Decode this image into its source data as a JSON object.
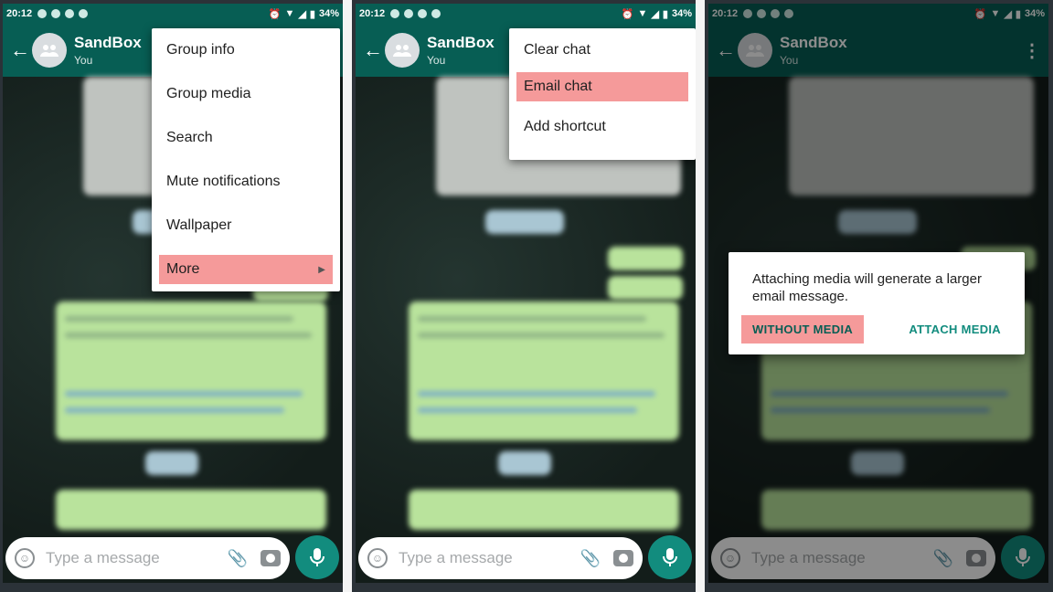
{
  "status": {
    "time": "20:12",
    "battery": "34%"
  },
  "chat": {
    "title": "SandBox",
    "subtitle": "You"
  },
  "input": {
    "placeholder": "Type a message"
  },
  "menu_main": {
    "items": [
      "Group info",
      "Group media",
      "Search",
      "Mute notifications",
      "Wallpaper",
      "More"
    ],
    "highlighted": "More"
  },
  "menu_more": {
    "items": [
      "Clear chat",
      "Email chat",
      "Add shortcut"
    ],
    "highlighted": "Email chat"
  },
  "dialog": {
    "message": "Attaching media will generate a larger email message.",
    "without_media": "WITHOUT MEDIA",
    "attach_media": "ATTACH MEDIA"
  },
  "colors": {
    "appbar": "#075e54",
    "accent": "#128c7e",
    "highlight": "#f59a9a"
  }
}
